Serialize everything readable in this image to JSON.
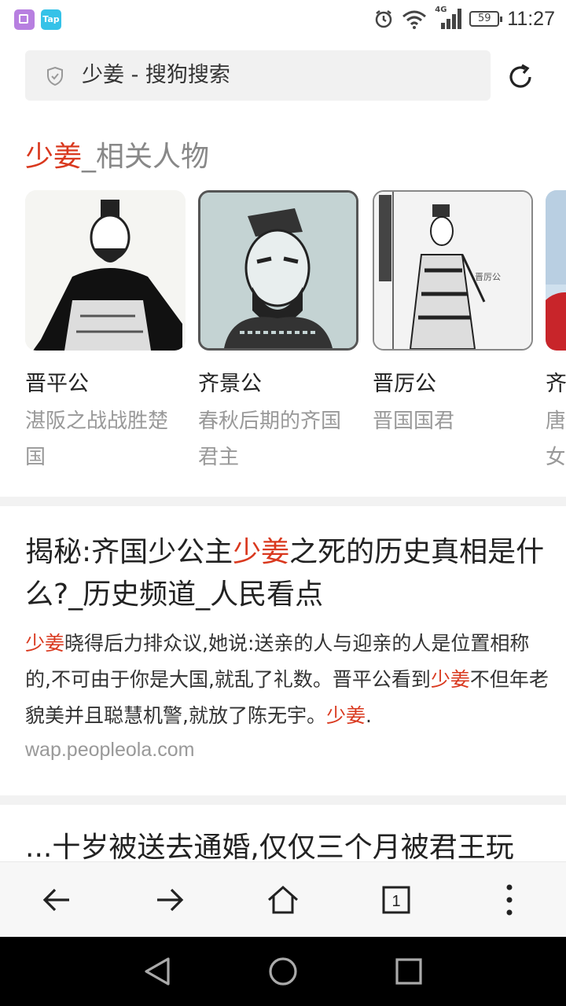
{
  "status_bar": {
    "network": "4G",
    "battery": "59",
    "time": "11:27",
    "tap_label": "Tap"
  },
  "address_bar": {
    "text": "少姜 - 搜狗搜索"
  },
  "related": {
    "title_highlight": "少姜",
    "title_rest": "_相关人物",
    "people": [
      {
        "name": "晋平公",
        "desc": "湛阪之战战胜楚国"
      },
      {
        "name": "齐景公",
        "desc": "春秋后期的齐国君主"
      },
      {
        "name": "晋厉公",
        "desc": "晋国国君"
      },
      {
        "name": "齐",
        "desc": "唐女"
      }
    ]
  },
  "result1": {
    "title_a": "揭秘:齐国少公主",
    "title_hl": "少姜",
    "title_b": "之死的历史真相是什么?_历史频道_人民看点",
    "snip_hl1": "少姜",
    "snip_a": "晓得后力排众议,她说:送亲的人与迎亲的人是位置相称的,不可由于你是大国,就乱了礼数。晋平公看到",
    "snip_hl2": "少姜",
    "snip_b": "不但年老貌美并且聪慧机警,就放了陈无宇。",
    "snip_hl3": "少姜",
    "snip_end": ".",
    "url": "wap.peopleola.com"
  },
  "result2": {
    "title": "...十岁被送去通婚,仅仅三个月被君王玩"
  },
  "colors": {
    "highlight": "#d9381e",
    "muted": "#999999"
  }
}
